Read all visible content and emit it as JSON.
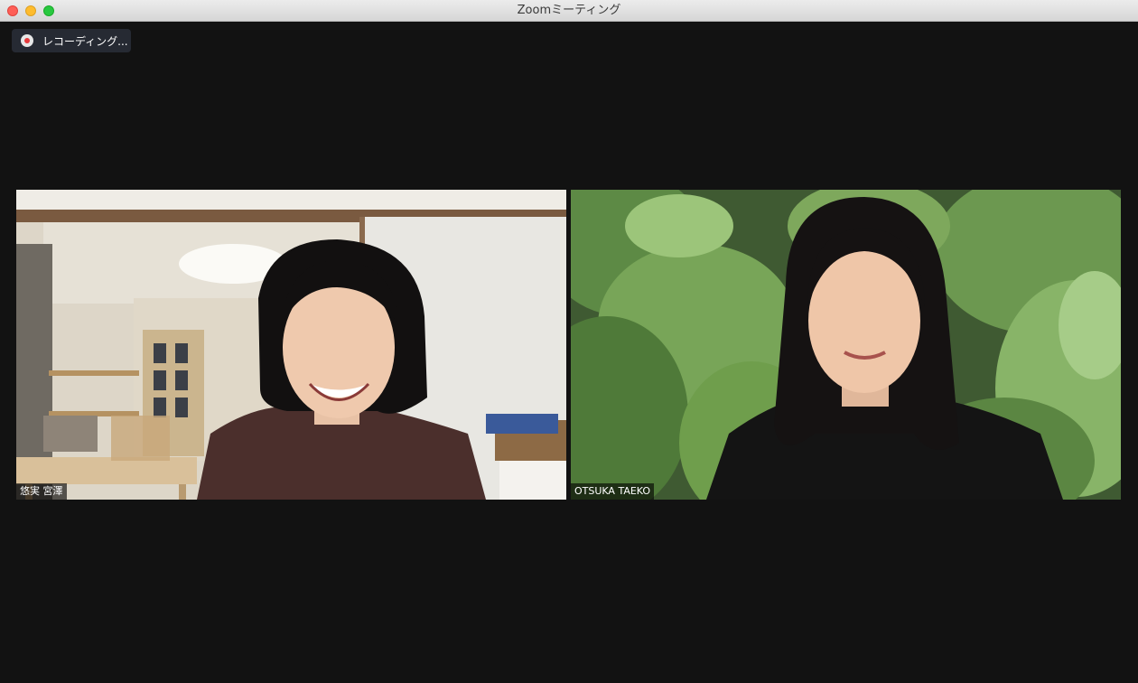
{
  "window": {
    "title": "Zoomミーティング"
  },
  "recording": {
    "label": "レコーディング...",
    "icon": "recording-dot-icon"
  },
  "participants": [
    {
      "name": "悠実 宮澤"
    },
    {
      "name": "OTSUKA TAEKO"
    }
  ],
  "colors": {
    "background": "#121212",
    "recording_pill": "#262a33",
    "recording_dot": "#e5393b"
  }
}
